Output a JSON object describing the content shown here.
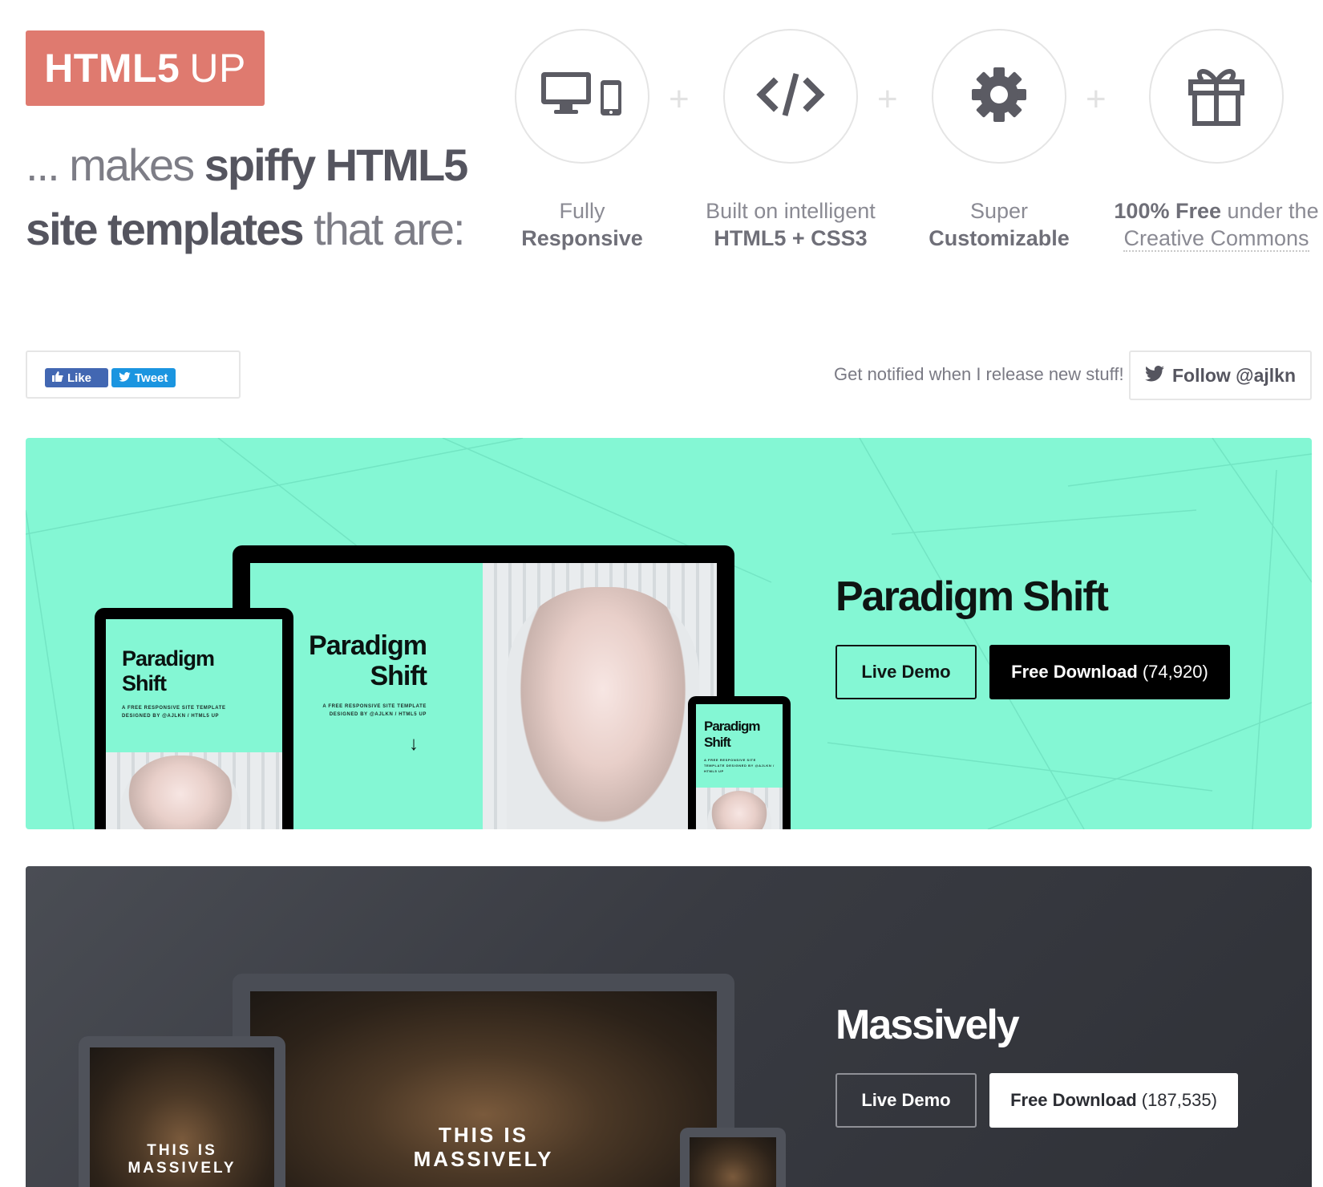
{
  "header": {
    "logo_strong": "HTML5",
    "logo_rest": "UP",
    "tagline": {
      "part1": "... makes ",
      "part2": "spiffy HTML5",
      "part3": "site templates",
      "part4": " that are:"
    }
  },
  "features": [
    {
      "icon": "devices-icon",
      "line1": "Fully",
      "line2": "Responsive"
    },
    {
      "icon": "code-icon",
      "line1": "Built on intelligent",
      "line2": "HTML5 + CSS3"
    },
    {
      "icon": "gear-icon",
      "line1": "Super",
      "line2": "Customizable"
    },
    {
      "icon": "gift-icon",
      "line1_bold": "100% Free",
      "line1_rest": " under the",
      "line2": "Creative Commons"
    }
  ],
  "social": {
    "like_label": "Like",
    "tweet_label": "Tweet",
    "notify_text": "Get notified when I release new stuff!",
    "follow_label": "Follow @ajlkn"
  },
  "templates": [
    {
      "title": "Paradigm Shift",
      "demo_label": "Live Demo",
      "download_label": "Free Download",
      "download_count": "(74,920)",
      "accent": "#84f7d4",
      "mock": {
        "title_line1": "Paradigm",
        "title_line2": "Shift",
        "subtitle": "A FREE RESPONSIVE SITE TEMPLATE DESIGNED BY @AJLKN / HTML5 UP"
      }
    },
    {
      "title": "Massively",
      "demo_label": "Live Demo",
      "download_label": "Free Download",
      "download_count": "(187,535)",
      "accent": "#3b3e45",
      "mock": {
        "headline_line1": "THIS IS",
        "headline_line2": "MASSIVELY"
      }
    }
  ]
}
